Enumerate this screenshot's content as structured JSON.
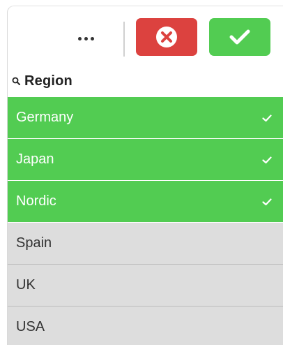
{
  "toolbar": {
    "more_icon": "more-horizontal-icon",
    "cancel_icon": "close-circle-icon",
    "confirm_icon": "checkmark-icon",
    "cancel_color": "#dc423f",
    "confirm_color": "#52cc52"
  },
  "search": {
    "icon": "search-icon",
    "label": "Region"
  },
  "list": {
    "selected_color": "#52cc52",
    "alternative_color": "#dddddd",
    "items": [
      {
        "label": "Germany",
        "state": "selected"
      },
      {
        "label": "Japan",
        "state": "selected"
      },
      {
        "label": "Nordic",
        "state": "selected"
      },
      {
        "label": "Spain",
        "state": "alternative"
      },
      {
        "label": "UK",
        "state": "alternative"
      },
      {
        "label": "USA",
        "state": "alternative"
      }
    ]
  }
}
